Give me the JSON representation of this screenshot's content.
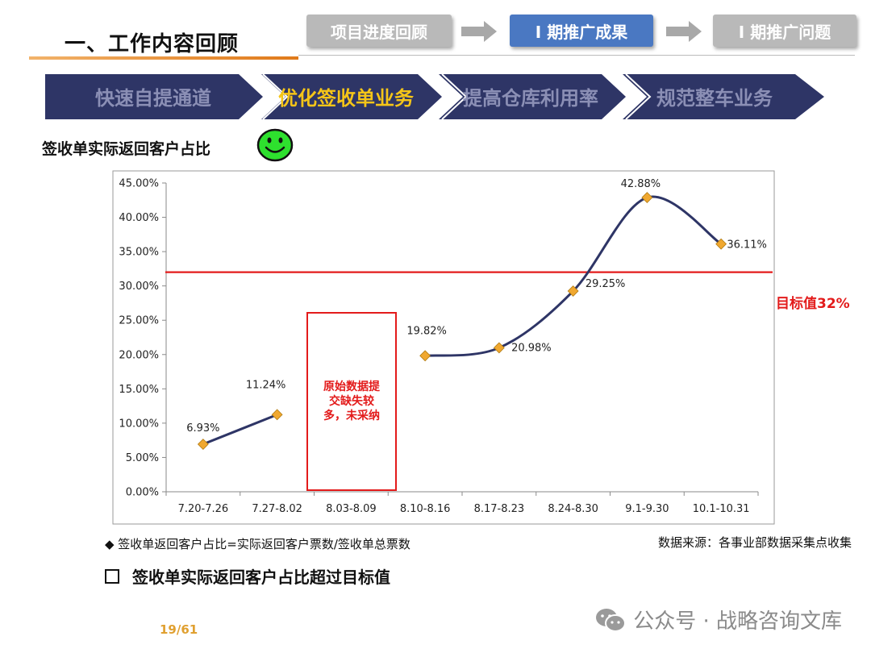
{
  "header": {
    "title": "一、工作内容回顾",
    "nav": [
      {
        "label": "项目进度回顾",
        "active": false
      },
      {
        "label": "I 期推广成果",
        "active": true
      },
      {
        "label": "I 期推广问题",
        "active": false
      }
    ]
  },
  "banner": {
    "items": [
      {
        "label": "快速自提通道",
        "active": false
      },
      {
        "label": "优化签收单业务",
        "active": true
      },
      {
        "label": "提高仓库利用率",
        "active": false
      },
      {
        "label": "规范整车业务",
        "active": false
      }
    ],
    "colors": {
      "fill": "#2e3566",
      "active_text": "#f5c518",
      "inactive_text": "#8b8fb5"
    }
  },
  "chart_title": "签收单实际返回客户占比",
  "chart_data": {
    "type": "line",
    "categories": [
      "7.20-7.26",
      "7.27-8.02",
      "8.03-8.09",
      "8.10-8.16",
      "8.17-8.23",
      "8.24-8.30",
      "9.1-9.30",
      "10.1-10.31"
    ],
    "series": [
      {
        "values": [
          6.93,
          11.24,
          null,
          19.82,
          20.98,
          29.25,
          42.88,
          36.11
        ],
        "labels": [
          "6.93%",
          "11.24%",
          "",
          "19.82%",
          "20.98%",
          "29.25%",
          "42.88%",
          "36.11%"
        ]
      }
    ],
    "ylim": [
      0,
      45
    ],
    "yticks": [
      "0.00%",
      "5.00%",
      "10.00%",
      "15.00%",
      "20.00%",
      "25.00%",
      "30.00%",
      "35.00%",
      "40.00%",
      "45.00%"
    ],
    "target": {
      "value": 32,
      "label": "目标值32%"
    },
    "annotation": "原始数据提交缺失较多，未采纳",
    "colors": {
      "line": "#2e3566",
      "marker": "#f0a830",
      "target": "#e31b1b"
    }
  },
  "footnote": "◆  签收单返回客户占比=实际返回客户票数/签收单总票数",
  "source": "数据来源：各事业部数据采集点收集",
  "conclusion": "签收单实际返回客户占比超过目标值",
  "page_number": "19/61",
  "watermark": "公众号 · 战略咨询文库"
}
